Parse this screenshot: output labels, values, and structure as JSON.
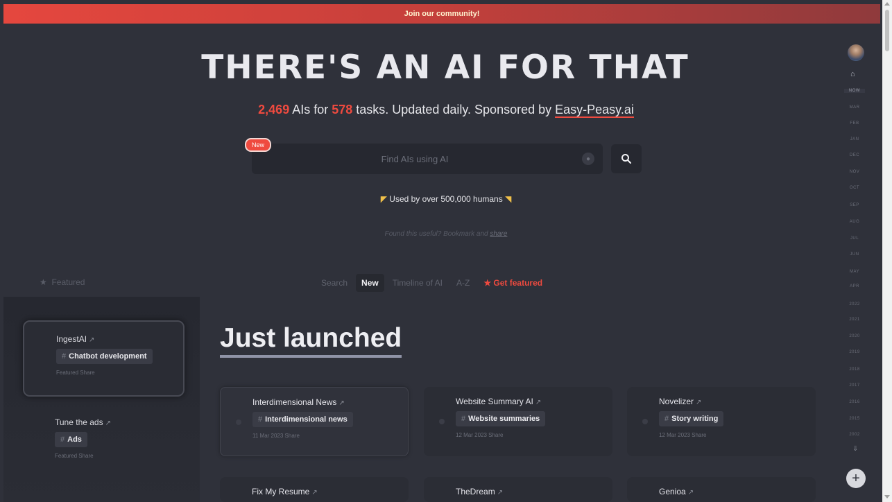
{
  "banner": {
    "text": "Join our community!"
  },
  "header": {
    "title": "THERE'S AN AI FOR THAT",
    "ai_count": "2,469",
    "text_ais_for": " AIs for ",
    "task_count": "578",
    "text_tasks": " tasks. Updated daily. Sponsored by ",
    "sponsor": "Easy-Peasy.ai"
  },
  "search": {
    "placeholder": "Find AIs using AI",
    "new_badge": "New"
  },
  "used_by": "Used by over 500,000 humans",
  "found_useful": {
    "text": "Found this useful? Bookmark and ",
    "share": "share"
  },
  "featured_label": "Featured",
  "tabs": [
    "Search",
    "New",
    "Timeline of AI",
    "A-Z",
    "Get featured"
  ],
  "featured": [
    {
      "name": "IngestAI",
      "tag": "Chatbot development",
      "meta": "Featured  Share"
    },
    {
      "name": "Tune the ads",
      "tag": "Ads",
      "meta": "Featured  Share"
    }
  ],
  "just_launched": "Just launched",
  "cards": [
    {
      "name": "Interdimensional News",
      "tag": "Interdimensional news",
      "meta": "11 Mar 2023  Share"
    },
    {
      "name": "Website Summary AI",
      "tag": "Website summaries",
      "meta": "12 Mar 2023  Share"
    },
    {
      "name": "Novelizer",
      "tag": "Story writing",
      "meta": "12 Mar 2023  Share"
    },
    {
      "name": "Fix My Resume",
      "tag": "",
      "meta": ""
    },
    {
      "name": "TheDream",
      "tag": "",
      "meta": ""
    },
    {
      "name": "Genioa",
      "tag": "",
      "meta": ""
    }
  ],
  "timeline": [
    "NOW",
    "MAR",
    "FEB",
    "JAN",
    "DEC",
    "NOV",
    "OCT",
    "SEP",
    "AUG",
    "JUL",
    "JUN",
    "MAY",
    "APR",
    "2022",
    "2021",
    "2020",
    "2019",
    "2018",
    "2017",
    "2016",
    "2015",
    "2002"
  ],
  "colors": {
    "accent": "#ef4a3f",
    "bg": "#2f313a",
    "card": "#2b2d35"
  }
}
